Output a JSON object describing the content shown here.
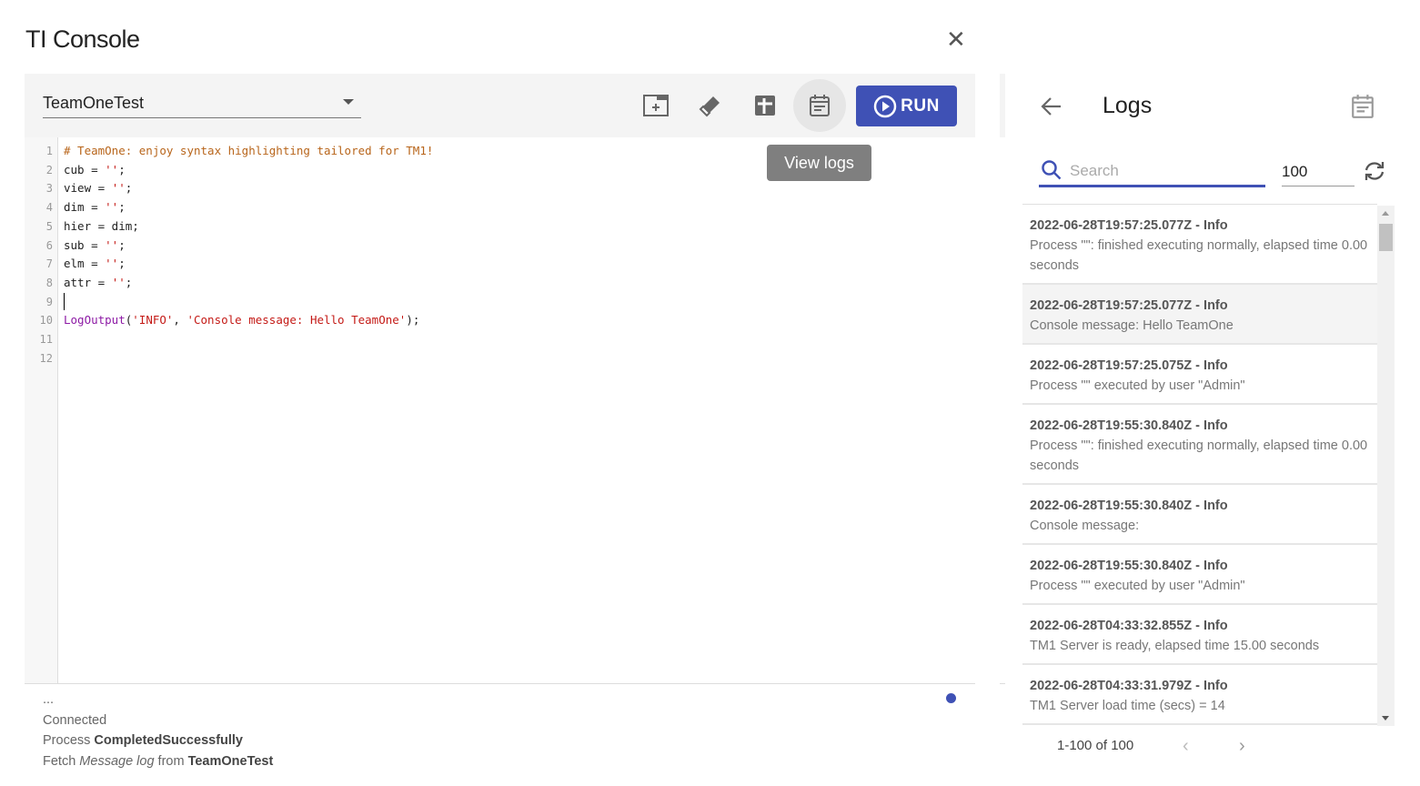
{
  "title": "TI Console",
  "toolbar": {
    "process": "TeamOneTest",
    "run_label": "RUN",
    "tooltip": "View logs"
  },
  "editor": {
    "lines": [
      {
        "n": "1",
        "parts": [
          {
            "c": "cm",
            "t": "# TeamOne: enjoy syntax highlighting tailored for TM1!"
          }
        ]
      },
      {
        "n": "2",
        "parts": [
          {
            "c": "",
            "t": "cub = "
          },
          {
            "c": "st",
            "t": "''"
          },
          {
            "c": "",
            "t": ";"
          }
        ]
      },
      {
        "n": "3",
        "parts": [
          {
            "c": "",
            "t": "view = "
          },
          {
            "c": "st",
            "t": "''"
          },
          {
            "c": "",
            "t": ";"
          }
        ]
      },
      {
        "n": "4",
        "parts": [
          {
            "c": "",
            "t": "dim = "
          },
          {
            "c": "st",
            "t": "''"
          },
          {
            "c": "",
            "t": ";"
          }
        ]
      },
      {
        "n": "5",
        "parts": [
          {
            "c": "",
            "t": "hier = dim;"
          }
        ]
      },
      {
        "n": "6",
        "parts": [
          {
            "c": "",
            "t": "sub = "
          },
          {
            "c": "st",
            "t": "''"
          },
          {
            "c": "",
            "t": ";"
          }
        ]
      },
      {
        "n": "7",
        "parts": [
          {
            "c": "",
            "t": "elm = "
          },
          {
            "c": "st",
            "t": "''"
          },
          {
            "c": "",
            "t": ";"
          }
        ]
      },
      {
        "n": "8",
        "parts": [
          {
            "c": "",
            "t": "attr = "
          },
          {
            "c": "st",
            "t": "''"
          },
          {
            "c": "",
            "t": ";"
          }
        ]
      },
      {
        "n": "9",
        "parts": []
      },
      {
        "n": "10",
        "parts": [
          {
            "c": "fn",
            "t": "LogOutput"
          },
          {
            "c": "",
            "t": "("
          },
          {
            "c": "st",
            "t": "'INFO'"
          },
          {
            "c": "",
            "t": ", "
          },
          {
            "c": "st",
            "t": "'Console message: Hello TeamOne'"
          },
          {
            "c": "",
            "t": ");"
          }
        ]
      },
      {
        "n": "11",
        "parts": []
      },
      {
        "n": "12",
        "parts": []
      }
    ]
  },
  "status": {
    "ellipsis": "...",
    "connected": "Connected",
    "process_prefix": "Process ",
    "process_state": "CompletedSuccessfully",
    "fetch_prefix": "Fetch ",
    "fetch_what": "Message log",
    "fetch_mid": " from ",
    "fetch_target": "TeamOneTest",
    "indicator_color": "#3f51b5"
  },
  "logs": {
    "title": "Logs",
    "search_placeholder": "Search",
    "count": "100",
    "items": [
      {
        "header": "2022-06-28T19:57:25.077Z - Info",
        "message": "Process \"\": finished executing normally, elapsed time 0.00 seconds"
      },
      {
        "header": "2022-06-28T19:57:25.077Z - Info",
        "message": "Console message: Hello TeamOne",
        "highlighted": true
      },
      {
        "header": "2022-06-28T19:57:25.075Z - Info",
        "message": "Process \"\" executed by user \"Admin\""
      },
      {
        "header": "2022-06-28T19:55:30.840Z - Info",
        "message": "Process \"\": finished executing normally, elapsed time 0.00 seconds"
      },
      {
        "header": "2022-06-28T19:55:30.840Z - Info",
        "message": "Console message:"
      },
      {
        "header": "2022-06-28T19:55:30.840Z - Info",
        "message": "Process \"\" executed by user \"Admin\""
      },
      {
        "header": "2022-06-28T04:33:32.855Z - Info",
        "message": "TM1 Server is ready, elapsed time 15.00 seconds"
      },
      {
        "header": "2022-06-28T04:33:31.979Z - Info",
        "message": "TM1 Server load time (secs) = 14"
      }
    ],
    "pager": "1-100 of 100"
  },
  "colors": {
    "accent": "#3f51b5",
    "tooltip": "#7f7f7f"
  }
}
